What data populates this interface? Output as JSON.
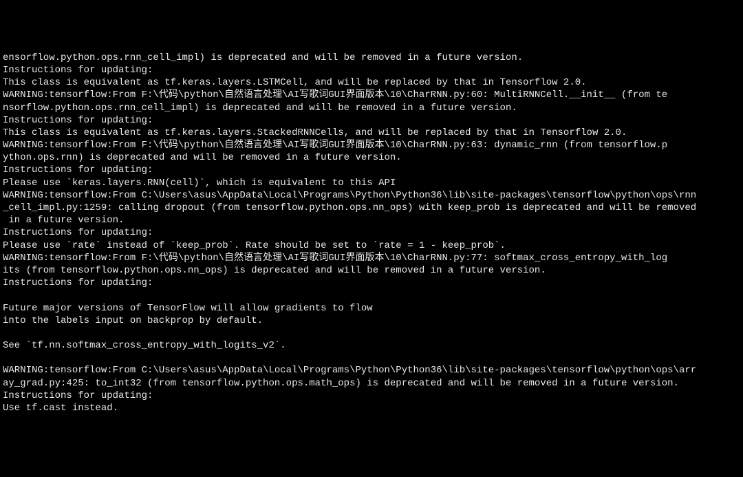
{
  "terminal": {
    "lines": [
      "ensorflow.python.ops.rnn_cell_impl) is deprecated and will be removed in a future version.",
      "Instructions for updating:",
      "This class is equivalent as tf.keras.layers.LSTMCell, and will be replaced by that in Tensorflow 2.0.",
      "WARNING:tensorflow:From F:\\代码\\python\\自然语言处理\\AI写歌词GUI界面版本\\10\\CharRNN.py:60: MultiRNNCell.__init__ (from te",
      "nsorflow.python.ops.rnn_cell_impl) is deprecated and will be removed in a future version.",
      "Instructions for updating:",
      "This class is equivalent as tf.keras.layers.StackedRNNCells, and will be replaced by that in Tensorflow 2.0.",
      "WARNING:tensorflow:From F:\\代码\\python\\自然语言处理\\AI写歌词GUI界面版本\\10\\CharRNN.py:63: dynamic_rnn (from tensorflow.p",
      "ython.ops.rnn) is deprecated and will be removed in a future version.",
      "Instructions for updating:",
      "Please use `keras.layers.RNN(cell)`, which is equivalent to this API",
      "WARNING:tensorflow:From C:\\Users\\asus\\AppData\\Local\\Programs\\Python\\Python36\\lib\\site-packages\\tensorflow\\python\\ops\\rnn",
      "_cell_impl.py:1259: calling dropout (from tensorflow.python.ops.nn_ops) with keep_prob is deprecated and will be removed",
      " in a future version.",
      "Instructions for updating:",
      "Please use `rate` instead of `keep_prob`. Rate should be set to `rate = 1 - keep_prob`.",
      "WARNING:tensorflow:From F:\\代码\\python\\自然语言处理\\AI写歌词GUI界面版本\\10\\CharRNN.py:77: softmax_cross_entropy_with_log",
      "its (from tensorflow.python.ops.nn_ops) is deprecated and will be removed in a future version.",
      "Instructions for updating:",
      "",
      "Future major versions of TensorFlow will allow gradients to flow",
      "into the labels input on backprop by default.",
      "",
      "See `tf.nn.softmax_cross_entropy_with_logits_v2`.",
      "",
      "WARNING:tensorflow:From C:\\Users\\asus\\AppData\\Local\\Programs\\Python\\Python36\\lib\\site-packages\\tensorflow\\python\\ops\\arr",
      "ay_grad.py:425: to_int32 (from tensorflow.python.ops.math_ops) is deprecated and will be removed in a future version.",
      "Instructions for updating:",
      "Use tf.cast instead."
    ]
  }
}
